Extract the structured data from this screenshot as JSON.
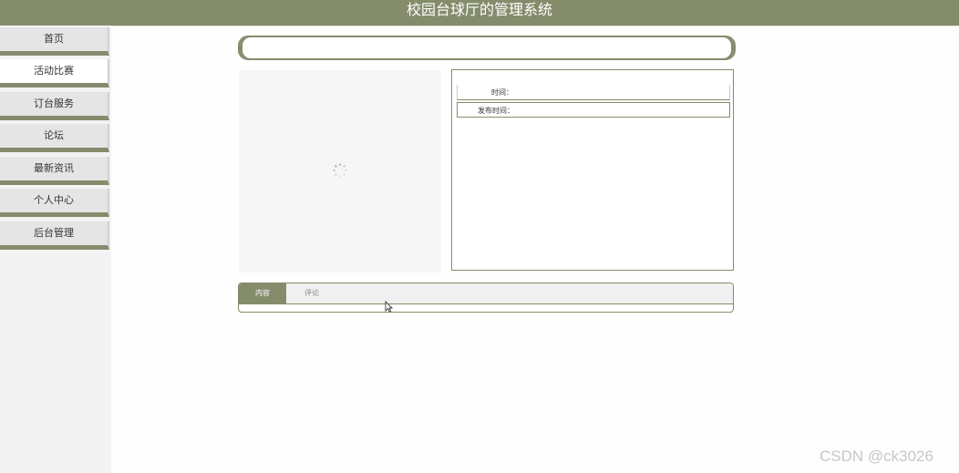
{
  "header": {
    "title": "校园台球厅的管理系统"
  },
  "sidebar": {
    "items": [
      {
        "label": "首页"
      },
      {
        "label": "活动比赛",
        "active": true
      },
      {
        "label": "订台服务"
      },
      {
        "label": "论坛"
      },
      {
        "label": "最新资讯"
      },
      {
        "label": "个人中心"
      },
      {
        "label": "后台管理"
      }
    ]
  },
  "detail": {
    "time_label": "时间：",
    "publish_time_label": "发布时间："
  },
  "tabs": {
    "content": "内容",
    "comments": "评论"
  },
  "watermark": "CSDN @ck3026",
  "colors": {
    "accent": "#848c6c",
    "sidebar_bg": "#f3f3f3",
    "nav_item_bg": "#e5e5e5"
  }
}
